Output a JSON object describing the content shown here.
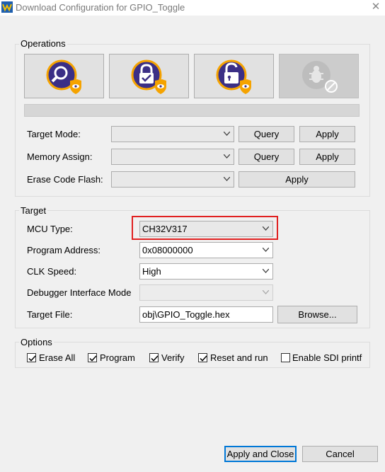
{
  "window": {
    "title": "Download Configuration for GPIO_Toggle",
    "close_glyph": "✕",
    "app_icon": "wch-logo-icon",
    "close_icon": "close-icon"
  },
  "operations": {
    "group_label": "Operations",
    "buttons": [
      {
        "icon": "query-magnifier-shield-icon",
        "enabled": true
      },
      {
        "icon": "lock-check-shield-icon",
        "enabled": true
      },
      {
        "icon": "unlock-shield-icon",
        "enabled": true
      },
      {
        "icon": "debug-bug-disabled-icon",
        "enabled": false
      }
    ],
    "progress_percent": 0,
    "target_mode": {
      "label": "Target Mode:",
      "value": "",
      "query_label": "Query",
      "apply_label": "Apply"
    },
    "memory_assign": {
      "label": "Memory Assign:",
      "value": "",
      "query_label": "Query",
      "apply_label": "Apply"
    },
    "erase_code_flash": {
      "label": "Erase Code Flash:",
      "value": "",
      "apply_label": "Apply"
    }
  },
  "target": {
    "group_label": "Target",
    "mcu_type": {
      "label": "MCU Type:",
      "value": "CH32V317"
    },
    "program_address": {
      "label": "Program Address:",
      "value": "0x08000000"
    },
    "clk_speed": {
      "label": "CLK Speed:",
      "value": "High"
    },
    "debugger_interface_mode": {
      "label": "Debugger Interface Mode",
      "value": ""
    },
    "target_file": {
      "label": "Target File:",
      "value": "obj\\GPIO_Toggle.hex",
      "browse_label": "Browse..."
    }
  },
  "options": {
    "group_label": "Options",
    "items": [
      {
        "label": "Erase All",
        "checked": true
      },
      {
        "label": "Program",
        "checked": true
      },
      {
        "label": "Verify",
        "checked": true
      },
      {
        "label": "Reset and run",
        "checked": true
      },
      {
        "label": "Enable SDI printf",
        "checked": false
      }
    ]
  },
  "footer": {
    "apply_close_label": "Apply and Close",
    "cancel_label": "Cancel"
  },
  "colors": {
    "highlight": "#e02020",
    "accent_gold": "#f5a300",
    "icon_purple": "#3b2f86",
    "primary_border": "#0078d7"
  }
}
